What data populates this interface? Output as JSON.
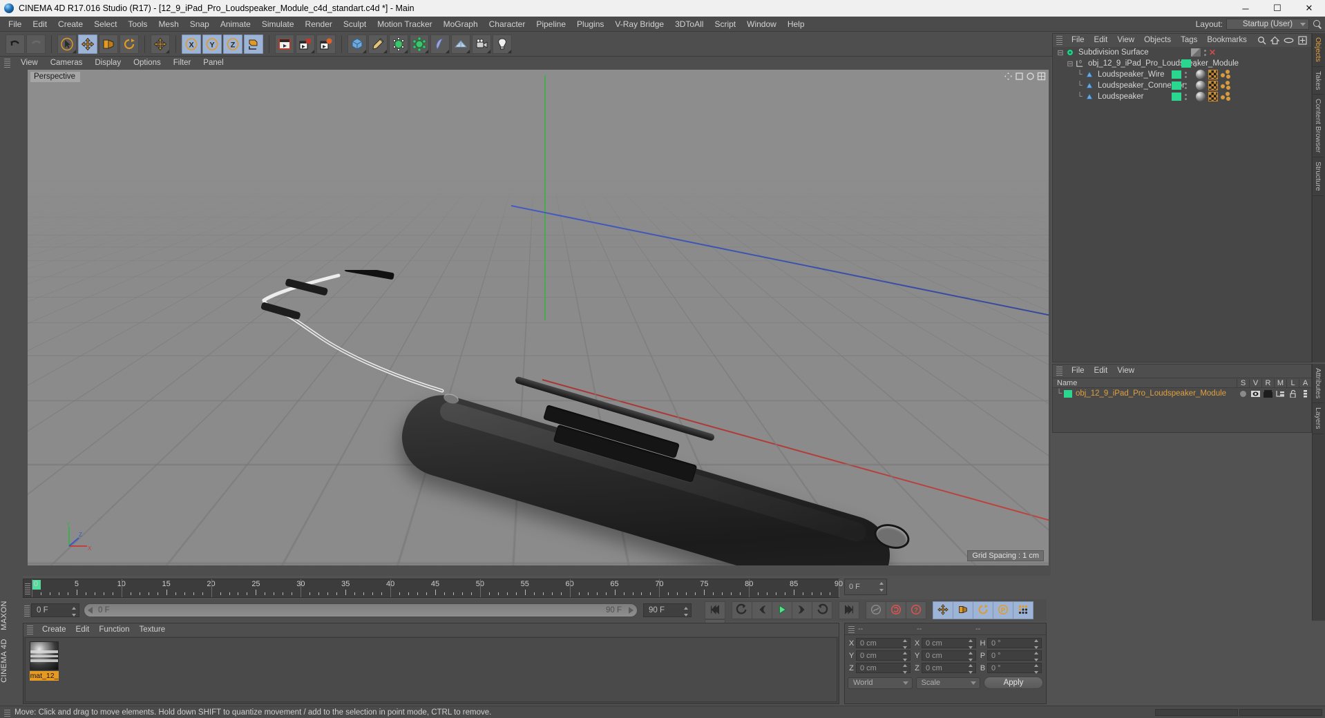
{
  "window": {
    "title": "CINEMA 4D R17.016 Studio (R17) - [12_9_iPad_Pro_Loudspeaker_Module_c4d_standart.c4d *] - Main",
    "minimize": "─",
    "maximize": "☐",
    "close": "✕"
  },
  "menubar": {
    "items": [
      "File",
      "Edit",
      "Create",
      "Select",
      "Tools",
      "Mesh",
      "Snap",
      "Animate",
      "Simulate",
      "Render",
      "Sculpt",
      "Motion Tracker",
      "MoGraph",
      "Character",
      "Pipeline",
      "Plugins",
      "V-Ray Bridge",
      "3DToAll",
      "Script",
      "Window",
      "Help"
    ],
    "layout_label": "Layout:",
    "layout_value": "Startup (User)"
  },
  "toolbar": {
    "groups": [
      {
        "name": "undo",
        "buttons": [
          {
            "name": "undo-button",
            "icon": "undo-icon",
            "selected": false,
            "corner": false
          },
          {
            "name": "redo-button",
            "icon": "redo-icon",
            "selected": false,
            "corner": false
          }
        ]
      },
      {
        "name": "transform",
        "buttons": [
          {
            "name": "live-selection-button",
            "icon": "cursor-icon",
            "selected": false,
            "corner": true
          },
          {
            "name": "move-button",
            "icon": "move-icon",
            "selected": true,
            "corner": false
          },
          {
            "name": "scale-button",
            "icon": "scale-icon",
            "selected": false,
            "corner": false
          },
          {
            "name": "rotate-button",
            "icon": "rotate-icon",
            "selected": false,
            "corner": false
          }
        ]
      },
      {
        "name": "axis",
        "buttons": [
          {
            "name": "move-axis-button",
            "icon": "move-icon",
            "selected": false,
            "corner": true
          }
        ]
      },
      {
        "name": "axis-lock",
        "buttons": [
          {
            "name": "lock-x-button",
            "icon": "x-axis-icon",
            "selected": true,
            "corner": false
          },
          {
            "name": "lock-y-button",
            "icon": "y-axis-icon",
            "selected": true,
            "corner": false
          },
          {
            "name": "lock-z-button",
            "icon": "z-axis-icon",
            "selected": true,
            "corner": false
          },
          {
            "name": "world-coordinates-button",
            "icon": "world-axis-icon",
            "selected": true,
            "corner": false
          }
        ]
      },
      {
        "name": "render",
        "buttons": [
          {
            "name": "render-view-button",
            "icon": "render-view-icon",
            "selected": false,
            "corner": false
          },
          {
            "name": "render-region-button",
            "icon": "render-region-icon",
            "selected": false,
            "corner": true
          },
          {
            "name": "render-settings-button",
            "icon": "render-settings-icon",
            "selected": false,
            "corner": false
          }
        ]
      },
      {
        "name": "create",
        "buttons": [
          {
            "name": "add-cube-button",
            "icon": "cube-icon",
            "selected": false,
            "corner": true
          },
          {
            "name": "add-spline-button",
            "icon": "pen-icon",
            "selected": false,
            "corner": true
          },
          {
            "name": "add-generator-button",
            "icon": "generator-icon",
            "selected": false,
            "corner": true
          },
          {
            "name": "add-deformer-button",
            "icon": "deformer-icon",
            "selected": false,
            "corner": true
          },
          {
            "name": "add-scene-button",
            "icon": "environment-icon",
            "selected": false,
            "corner": true
          },
          {
            "name": "add-floor-button",
            "icon": "floor-icon",
            "selected": false,
            "corner": true
          },
          {
            "name": "add-camera-button",
            "icon": "camera-icon",
            "selected": false,
            "corner": true
          },
          {
            "name": "add-light-button",
            "icon": "light-bulb-icon",
            "selected": false,
            "corner": true
          }
        ]
      }
    ]
  },
  "left_palette": {
    "buttons": [
      {
        "name": "tool-texture-axis",
        "icon": "texture-axis-icon"
      },
      {
        "name": "tool-point-mode",
        "icon": "point-mode-icon"
      },
      {
        "name": "tool-edge-mode",
        "icon": "edge-mode-icon"
      },
      {
        "name": "tool-polygon-mode",
        "icon": "polygon-mode-icon"
      },
      {
        "name": "tool-model-mode",
        "icon": "model-mode-icon"
      },
      {
        "name": "tool-object-mode",
        "icon": "object-mode-icon"
      },
      {
        "name": "tool-texture-mode",
        "icon": "texture-mode-icon"
      },
      {
        "name": "tool-workplane",
        "icon": "workplane-icon"
      },
      {
        "name": "tool-axis-modify",
        "icon": "axis-modify-icon"
      },
      {
        "name": "tool-snap",
        "icon": "snap-magnet-icon"
      },
      {
        "name": "tool-enable-axis",
        "icon": "enable-axis-icon"
      },
      {
        "name": "tool-quantize",
        "icon": "quantize-icon"
      },
      {
        "name": "tool-lock-axis",
        "icon": "lock-icon"
      },
      {
        "name": "tool-viewport-solo",
        "icon": "viewport-solo-icon"
      },
      {
        "name": "tool-layout-toggle",
        "icon": "layout-toggle-icon"
      }
    ],
    "brand_top": "MAXON",
    "brand_bottom": "CINEMA 4D"
  },
  "viewport": {
    "menu": [
      "View",
      "Cameras",
      "Display",
      "Options",
      "Filter",
      "Panel"
    ],
    "label": "Perspective",
    "grid_spacing": "Grid Spacing : 1 cm",
    "axis_labels": {
      "x": "X",
      "y": "Y",
      "z": "Z"
    }
  },
  "object_manager": {
    "menu": [
      "File",
      "Edit",
      "View",
      "Objects",
      "Tags",
      "Bookmarks"
    ],
    "icons": [
      "search-icon",
      "home-icon",
      "eye-icon",
      "new-window-icon"
    ],
    "rows": [
      {
        "name": "Subdivision Surface",
        "indent": 0,
        "icon": "subdivision-surface-icon",
        "visibility": "half",
        "has_x": true,
        "tags": []
      },
      {
        "name": "obj_12_9_iPad_Pro_Loudspeaker_Module",
        "indent": 1,
        "icon": "null-object-icon",
        "visibility": "green",
        "has_x": false,
        "tags": []
      },
      {
        "name": "Loudspeaker_Wire",
        "indent": 2,
        "icon": "polygon-object-icon",
        "visibility": "green",
        "has_x": false,
        "tags": [
          "material-tag",
          "uv-tag",
          "selection-tag"
        ]
      },
      {
        "name": "Loudspeaker_Connector",
        "indent": 2,
        "icon": "polygon-object-icon",
        "visibility": "green",
        "has_x": false,
        "tags": [
          "material-tag",
          "uv-tag",
          "selection-tag"
        ]
      },
      {
        "name": "Loudspeaker",
        "indent": 2,
        "icon": "polygon-object-icon",
        "visibility": "green",
        "has_x": false,
        "tags": [
          "material-tag",
          "uv-tag",
          "selection-tag"
        ]
      }
    ],
    "side_tabs": [
      "Objects",
      "Takes",
      "Content Browser",
      "Structure"
    ]
  },
  "layer_manager": {
    "menu": [
      "File",
      "Edit",
      "View"
    ],
    "columns": [
      "Name",
      "S",
      "V",
      "R",
      "M",
      "L",
      "A"
    ],
    "rows": [
      {
        "name": "obj_12_9_iPad_Pro_Loudspeaker_Module",
        "color": "#2bd78f"
      }
    ],
    "side_tabs": [
      "Attributes",
      "Layers"
    ]
  },
  "timeline": {
    "ticks": [
      0,
      5,
      10,
      15,
      20,
      25,
      30,
      35,
      40,
      45,
      50,
      55,
      60,
      65,
      70,
      75,
      80,
      85,
      90
    ],
    "min": 0,
    "max": 90,
    "current_frame": "0 F"
  },
  "animation_bar": {
    "current_frame_field": "0 F",
    "range_start_label": "0 F",
    "range_end_label": "90 F",
    "end_frame_field": "90 F",
    "buttons": [
      {
        "name": "go-to-start-button",
        "icon": "skip-start-icon",
        "highlight": false
      },
      {
        "name": "play-backwards-button",
        "icon": "play-back-icon",
        "highlight": false
      },
      {
        "name": "previous-frame-button",
        "icon": "step-back-icon",
        "highlight": false
      },
      {
        "name": "play-button",
        "icon": "play-icon",
        "highlight": false
      },
      {
        "name": "next-frame-button",
        "icon": "step-forward-icon",
        "highlight": false
      },
      {
        "name": "play-forward-loop-button",
        "icon": "loop-icon",
        "highlight": false
      },
      {
        "name": "go-to-end-button",
        "icon": "skip-end-icon",
        "highlight": false
      },
      {
        "name": "record-active-objects-button",
        "icon": "key-icon",
        "highlight": false
      },
      {
        "name": "autokeying-button",
        "icon": "autokey-icon",
        "highlight": false
      },
      {
        "name": "keyframe-selection-button",
        "icon": "question-icon",
        "highlight": false
      },
      {
        "name": "position-key-button",
        "icon": "position-key-icon",
        "highlight": true
      },
      {
        "name": "scale-key-button",
        "icon": "scale-key-icon",
        "highlight": true
      },
      {
        "name": "rotation-key-button",
        "icon": "rotation-key-icon",
        "highlight": true
      },
      {
        "name": "parameter-key-button",
        "icon": "parameter-key-icon",
        "highlight": true
      },
      {
        "name": "point-level-animation-button",
        "icon": "pla-icon",
        "highlight": true
      },
      {
        "name": "timeline-toggle-button",
        "icon": "filmstrip-icon",
        "highlight": false
      }
    ]
  },
  "material_manager": {
    "menu": [
      "Create",
      "Edit",
      "Function",
      "Texture"
    ],
    "materials": [
      {
        "name": "mat_12_",
        "selected": true
      }
    ]
  },
  "coordinate_manager": {
    "headers": [
      "--",
      "--",
      "--"
    ],
    "rows": [
      {
        "pos_label": "X",
        "pos_value": "0 cm",
        "size_label": "X",
        "size_value": "0 cm",
        "rot_label": "H",
        "rot_value": "0 °"
      },
      {
        "pos_label": "Y",
        "pos_value": "0 cm",
        "size_label": "Y",
        "size_value": "0 cm",
        "rot_label": "P",
        "rot_value": "0 °"
      },
      {
        "pos_label": "Z",
        "pos_value": "0 cm",
        "size_label": "Z",
        "size_value": "0 cm",
        "rot_label": "B",
        "rot_value": "0 °"
      }
    ],
    "coordinate_system": "World",
    "mode": "Scale",
    "apply_label": "Apply"
  },
  "status_bar": {
    "message": "Move: Click and drag to move elements. Hold down SHIFT to quantize movement / add to the selection in point mode, CTRL to remove."
  },
  "colors": {
    "accent_green": "#2bd78f",
    "accent_orange": "#e79a22",
    "highlight_blue": "#9db4d6",
    "panel_bg": "#4a4a4a",
    "viewport_bg": "#8b8b8b"
  }
}
